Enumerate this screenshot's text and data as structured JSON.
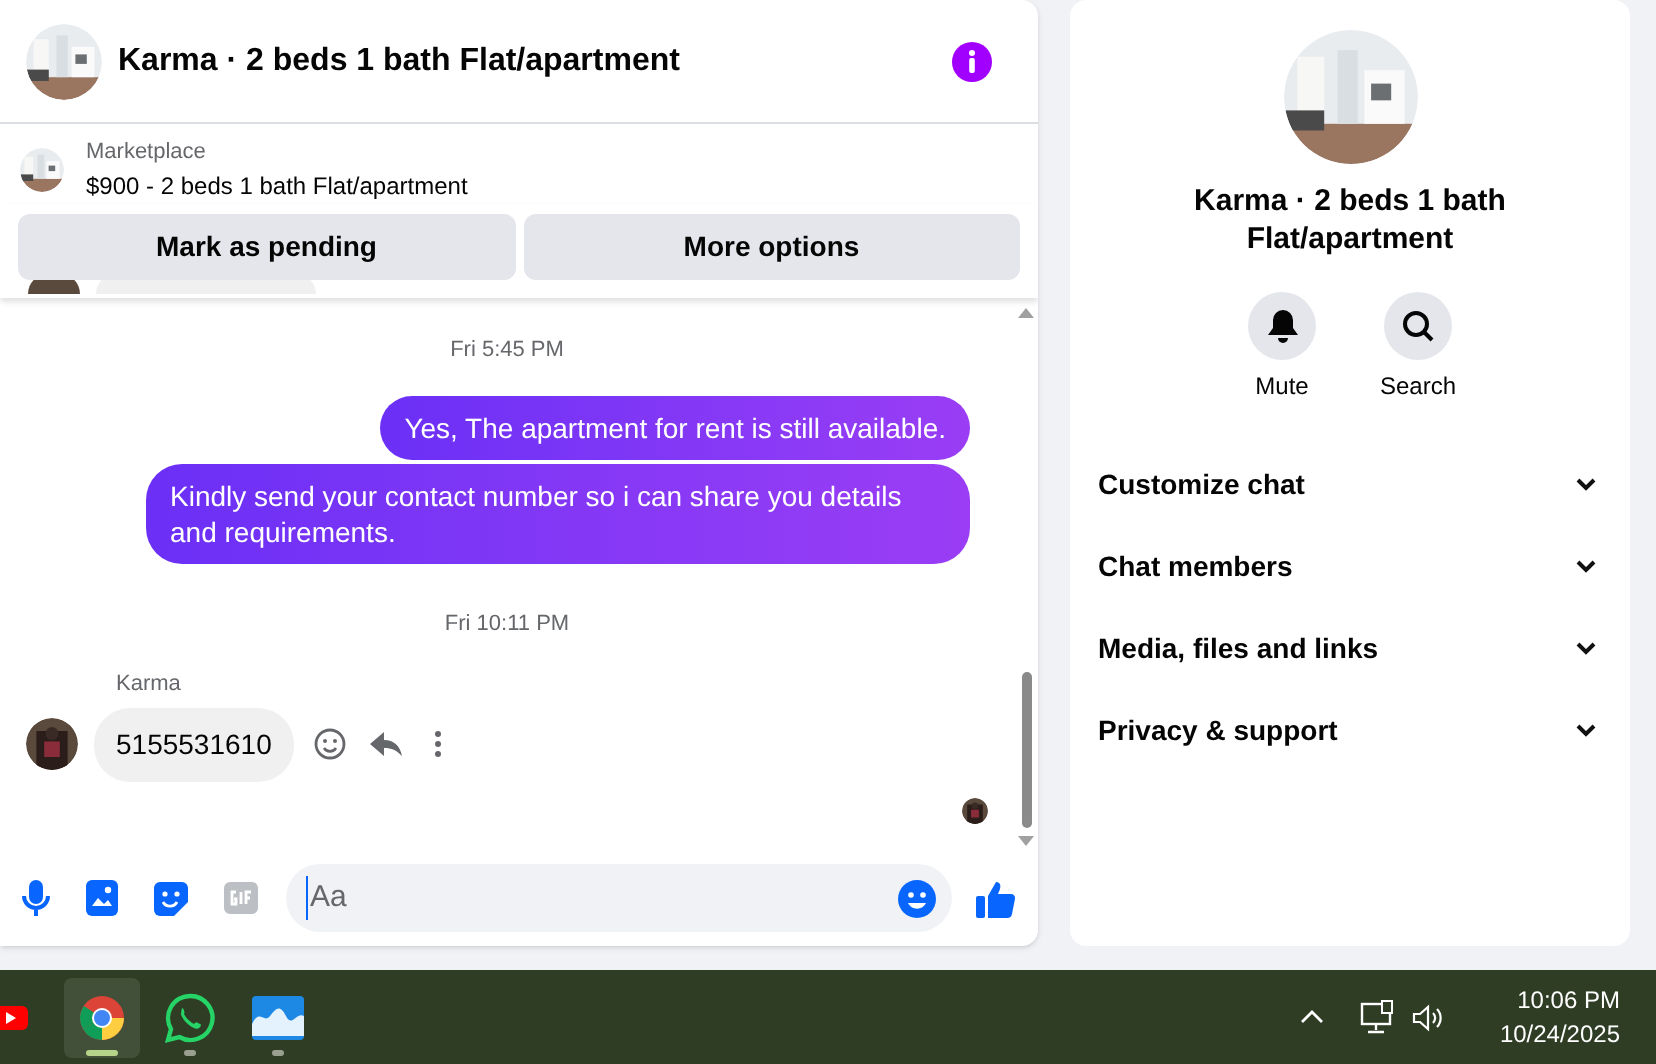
{
  "chat": {
    "title": "Karma · 2 beds 1 bath Flat/apartment",
    "listing": {
      "label": "Marketplace",
      "text": "$900 - 2 beds 1 bath Flat/apartment"
    },
    "actions": [
      "Mark as pending",
      "More options"
    ],
    "messages": [
      {
        "kind": "partial"
      },
      {
        "kind": "time",
        "text": "Fri 5:45 PM"
      },
      {
        "kind": "outgoing",
        "text": "Yes, The apartment for rent is still available."
      },
      {
        "kind": "outgoing",
        "text": "Kindly send your contact number so i can share you details and requirements."
      },
      {
        "kind": "time",
        "text": "Fri 10:11 PM"
      },
      {
        "kind": "incoming",
        "sender": "Karma",
        "text": "5155531610"
      }
    ],
    "composer": {
      "placeholder": "Aa"
    }
  },
  "details": {
    "title": "Karma · 2 beds 1 bath Flat/apartment",
    "actions": [
      "Mute",
      "Search"
    ],
    "sections": [
      {
        "label": "Customize chat",
        "expanded": false
      },
      {
        "label": "Chat members",
        "expanded": false
      },
      {
        "label": "Media, files and links",
        "expanded": false
      },
      {
        "label": "Privacy & support",
        "expanded": false
      }
    ]
  },
  "taskbar": {
    "apps": [
      {
        "kind": "youtube",
        "selected": false
      },
      {
        "kind": "chrome",
        "selected": true
      },
      {
        "kind": "whatsapp",
        "selected": false
      },
      {
        "kind": "viewer",
        "selected": false
      }
    ],
    "time": "10:06 PM",
    "date": "10/24/2025"
  }
}
